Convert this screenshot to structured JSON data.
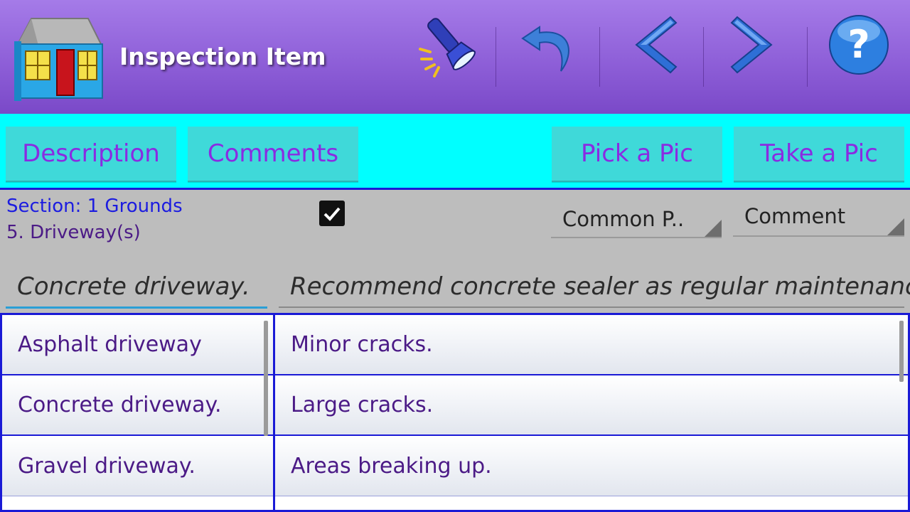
{
  "actionbar": {
    "title": "Inspection Item",
    "icons": [
      "house-icon",
      "flashlight-icon",
      "undo-icon",
      "back-chevron-icon",
      "forward-chevron-icon",
      "help-icon"
    ]
  },
  "buttons": {
    "description": "Description",
    "comments": "Comments",
    "pick_pic": "Pick a Pic",
    "take_pic": "Take a Pic"
  },
  "info": {
    "section": "Section: 1 Grounds",
    "item": "5. Driveway(s)",
    "checked": true,
    "spinner_common": "Common P..",
    "spinner_comment": "Comment",
    "description_value": "Concrete driveway.",
    "comment_value": "Recommend concrete sealer as regular maintenance."
  },
  "lists": {
    "descriptions": [
      "Asphalt driveway",
      "Concrete driveway.",
      "Gravel driveway."
    ],
    "comments": [
      "Minor cracks.",
      "Large cracks.",
      "Areas breaking up."
    ]
  },
  "colors": {
    "actionbar": "#8e5fd8",
    "button_bar": "#00ffff",
    "button": "#3fd9d9",
    "button_text": "#8a2be2",
    "border_blue": "#1a1ad6",
    "list_text": "#4b1a86"
  }
}
